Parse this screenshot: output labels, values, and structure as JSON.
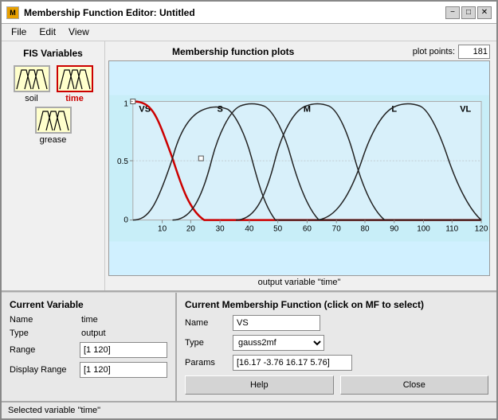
{
  "window": {
    "title": "Membership Function Editor: Untitled",
    "title_icon": "MF"
  },
  "menu": {
    "items": [
      "File",
      "Edit",
      "View"
    ]
  },
  "fis_variables": {
    "label": "FIS Variables",
    "vars": [
      {
        "name": "soil",
        "selected": false,
        "type": "input"
      },
      {
        "name": "time",
        "selected": true,
        "type": "output"
      },
      {
        "name": "grease",
        "selected": false,
        "type": "input"
      }
    ]
  },
  "plot": {
    "title": "Membership function plots",
    "plot_points_label": "plot points:",
    "plot_points_value": "181",
    "x_axis_label": "output variable \"time\"",
    "mf_labels": [
      "VS",
      "S",
      "M",
      "L",
      "VL"
    ],
    "x_ticks": [
      10,
      20,
      30,
      40,
      50,
      60,
      70,
      80,
      90,
      100,
      110,
      120
    ],
    "y_ticks": [
      "1",
      "0.5",
      "0"
    ]
  },
  "current_variable": {
    "title": "Current Variable",
    "name_label": "Name",
    "name_value": "time",
    "type_label": "Type",
    "type_value": "output",
    "range_label": "Range",
    "range_value": "[1 120]",
    "display_range_label": "Display Range",
    "display_range_value": "[1 120]"
  },
  "current_mf": {
    "title": "Current Membership Function (click on MF to select)",
    "name_label": "Name",
    "name_value": "VS",
    "type_label": "Type",
    "type_value": "gauss2mf",
    "params_label": "Params",
    "params_value": "[16.17 -3.76 16.17 5.76]",
    "help_btn": "Help",
    "close_btn": "Close"
  },
  "status": {
    "text": "Selected variable \"time\""
  }
}
